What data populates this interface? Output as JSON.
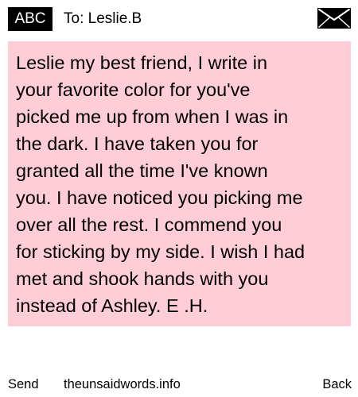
{
  "header": {
    "badge_label": "ABC",
    "recipient_label": "To: Leslie.B",
    "envelope_icon": "envelope-icon"
  },
  "message": {
    "text": "Leslie my best friend, I write in\nyour favorite color for you've\npicked me up from when I was in\nthe dark. I have taken you for\ngranted all the time I've known\nyou. I have noticed you picking me\nover all the rest. I commend you\nfor sticking by my side. I wish I had\nmet and shook hands with you\ninstead of Ashley. E .H.",
    "background_color": "#ffcdd7"
  },
  "footer": {
    "send_label": "Send",
    "site_label": "theunsaidwords.info",
    "back_label": "Back"
  }
}
